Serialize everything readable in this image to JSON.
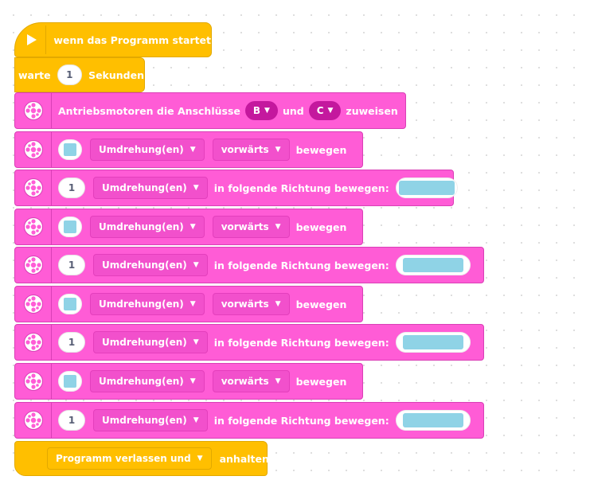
{
  "start_block": {
    "label": "wenn das Programm startet",
    "icon": "play-flag-icon"
  },
  "wait_block": {
    "prefix": "warte",
    "value": "1",
    "suffix": "Sekunden"
  },
  "assign_block": {
    "prefix": "Antriebsmotoren die Anschlüsse",
    "port1": "B",
    "middle": "und",
    "port2": "C",
    "suffix": "zuweisen"
  },
  "motor_rows": [
    {
      "type": "move",
      "unit": "Umdrehung(en)",
      "direction": "vorwärts",
      "suffix": "bewegen"
    },
    {
      "type": "steer",
      "value": "1",
      "unit": "Umdrehung(en)",
      "label": "in folgende Richtung bewegen:"
    },
    {
      "type": "move",
      "unit": "Umdrehung(en)",
      "direction": "vorwärts",
      "suffix": "bewegen"
    },
    {
      "type": "steer",
      "value": "1",
      "unit": "Umdrehung(en)",
      "label": "in folgende Richtung bewegen:"
    },
    {
      "type": "move",
      "unit": "Umdrehung(en)",
      "direction": "vorwärts",
      "suffix": "bewegen"
    },
    {
      "type": "steer",
      "value": "1",
      "unit": "Umdrehung(en)",
      "label": "in folgende Richtung bewegen:"
    },
    {
      "type": "move",
      "unit": "Umdrehung(en)",
      "direction": "vorwärts",
      "suffix": "bewegen"
    },
    {
      "type": "steer",
      "value": "1",
      "unit": "Umdrehung(en)",
      "label": "in folgende Richtung bewegen:"
    }
  ],
  "end_block": {
    "option": "Programm verlassen und",
    "suffix": "anhalten"
  },
  "colors": {
    "events_yellow": "#ffbf00",
    "motor_pink": "#ff5cd6",
    "port_magenta": "#c4189e",
    "input_blue": "#8fd3e6"
  }
}
